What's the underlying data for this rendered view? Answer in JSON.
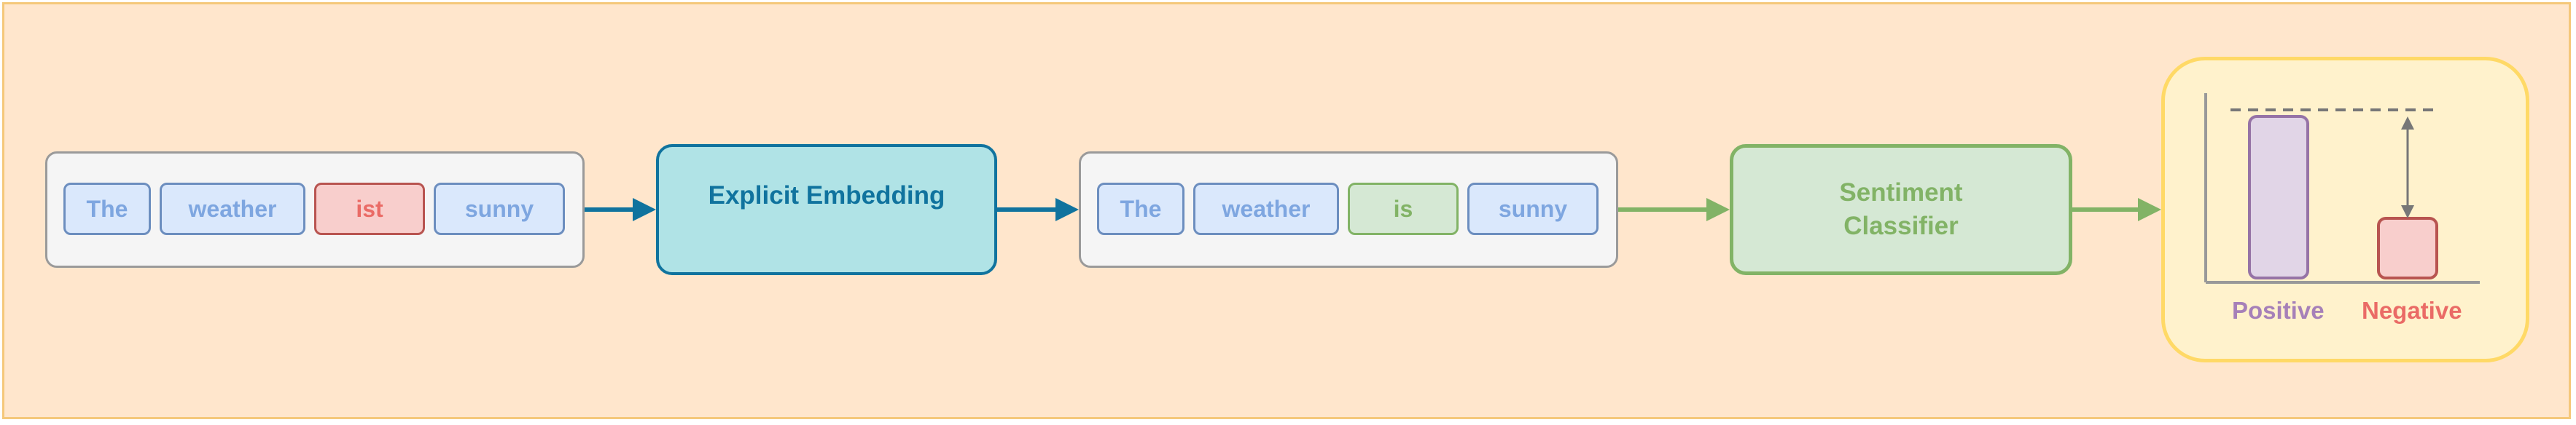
{
  "input_tokens": [
    {
      "text": "The",
      "style": "blue"
    },
    {
      "text": "weather",
      "style": "blue"
    },
    {
      "text": "ist",
      "style": "red"
    },
    {
      "text": "sunny",
      "style": "blue"
    }
  ],
  "embedding_label": "Explicit Embedding",
  "output_tokens": [
    {
      "text": "The",
      "style": "blue"
    },
    {
      "text": "weather",
      "style": "blue"
    },
    {
      "text": "is",
      "style": "green"
    },
    {
      "text": "sunny",
      "style": "blue"
    }
  ],
  "classifier_label": [
    "Sentiment",
    "Classifier"
  ],
  "result": {
    "positive_label": "Positive",
    "negative_label": "Negative"
  },
  "colors": {
    "background": "#ffe6cc",
    "embedding": "#b0e3e6",
    "classifier": "#d5e8d4",
    "result_panel": "#fff2cc",
    "positive": "#e1d5e7",
    "negative": "#f8cecc"
  }
}
